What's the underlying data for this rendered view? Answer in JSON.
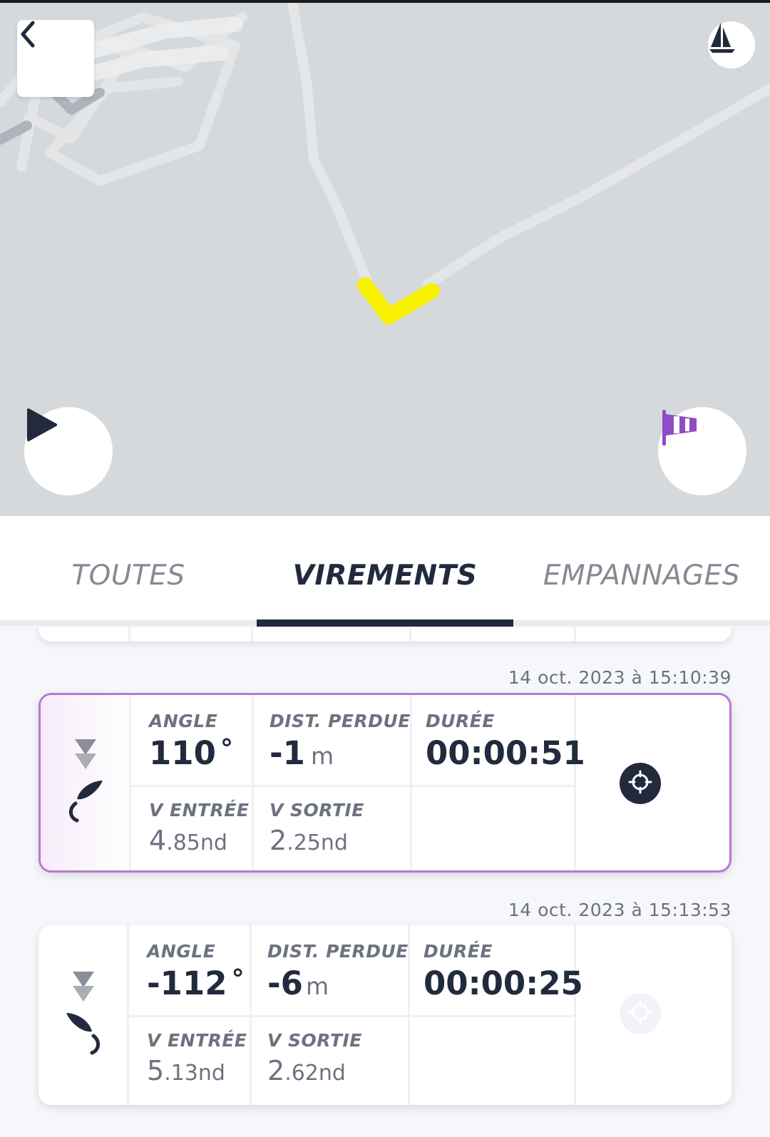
{
  "map": {
    "track_highlight_color": "#f7f000",
    "back_icon": "chevron-left-icon",
    "boat_icon": "sailboat-icon",
    "play_icon": "play-icon",
    "wind_icon": "windsock-icon"
  },
  "tabs": [
    {
      "label": "TOUTES",
      "active": false
    },
    {
      "label": "VIREMENTS",
      "active": true
    },
    {
      "label": "EMPANNAGES",
      "active": false
    }
  ],
  "maneuvers": [
    {
      "timestamp": "14 oct. 2023 à 15:10:39",
      "selected": true,
      "angle_label": "ANGLE",
      "angle": "110",
      "angle_unit": "°",
      "dist_label": "DIST. PERDUE",
      "dist": "-1",
      "dist_unit": "m",
      "duree_label": "DURÉE",
      "duree": "00:00:51",
      "ventree_label": "V ENTRÉE",
      "ventree_int": "4",
      "ventree_dec": ".85",
      "ventree_unit": "nd",
      "vsortie_label": "V SORTIE",
      "vsortie_int": "2",
      "vsortie_dec": ".25",
      "vsortie_unit": "nd",
      "locate_icon": "locate-target-icon"
    },
    {
      "timestamp": "14 oct. 2023 à 15:13:53",
      "selected": false,
      "angle_label": "ANGLE",
      "angle": "-112",
      "angle_unit": "°",
      "dist_label": "DIST. PERDUE",
      "dist": "-6",
      "dist_unit": "m",
      "duree_label": "DURÉE",
      "duree": "00:00:25",
      "ventree_label": "V ENTRÉE",
      "ventree_int": "5",
      "ventree_dec": ".13",
      "ventree_unit": "nd",
      "vsortie_label": "V SORTIE",
      "vsortie_int": "2",
      "vsortie_dec": ".62",
      "vsortie_unit": "nd",
      "locate_icon": "locate-target-icon"
    }
  ]
}
